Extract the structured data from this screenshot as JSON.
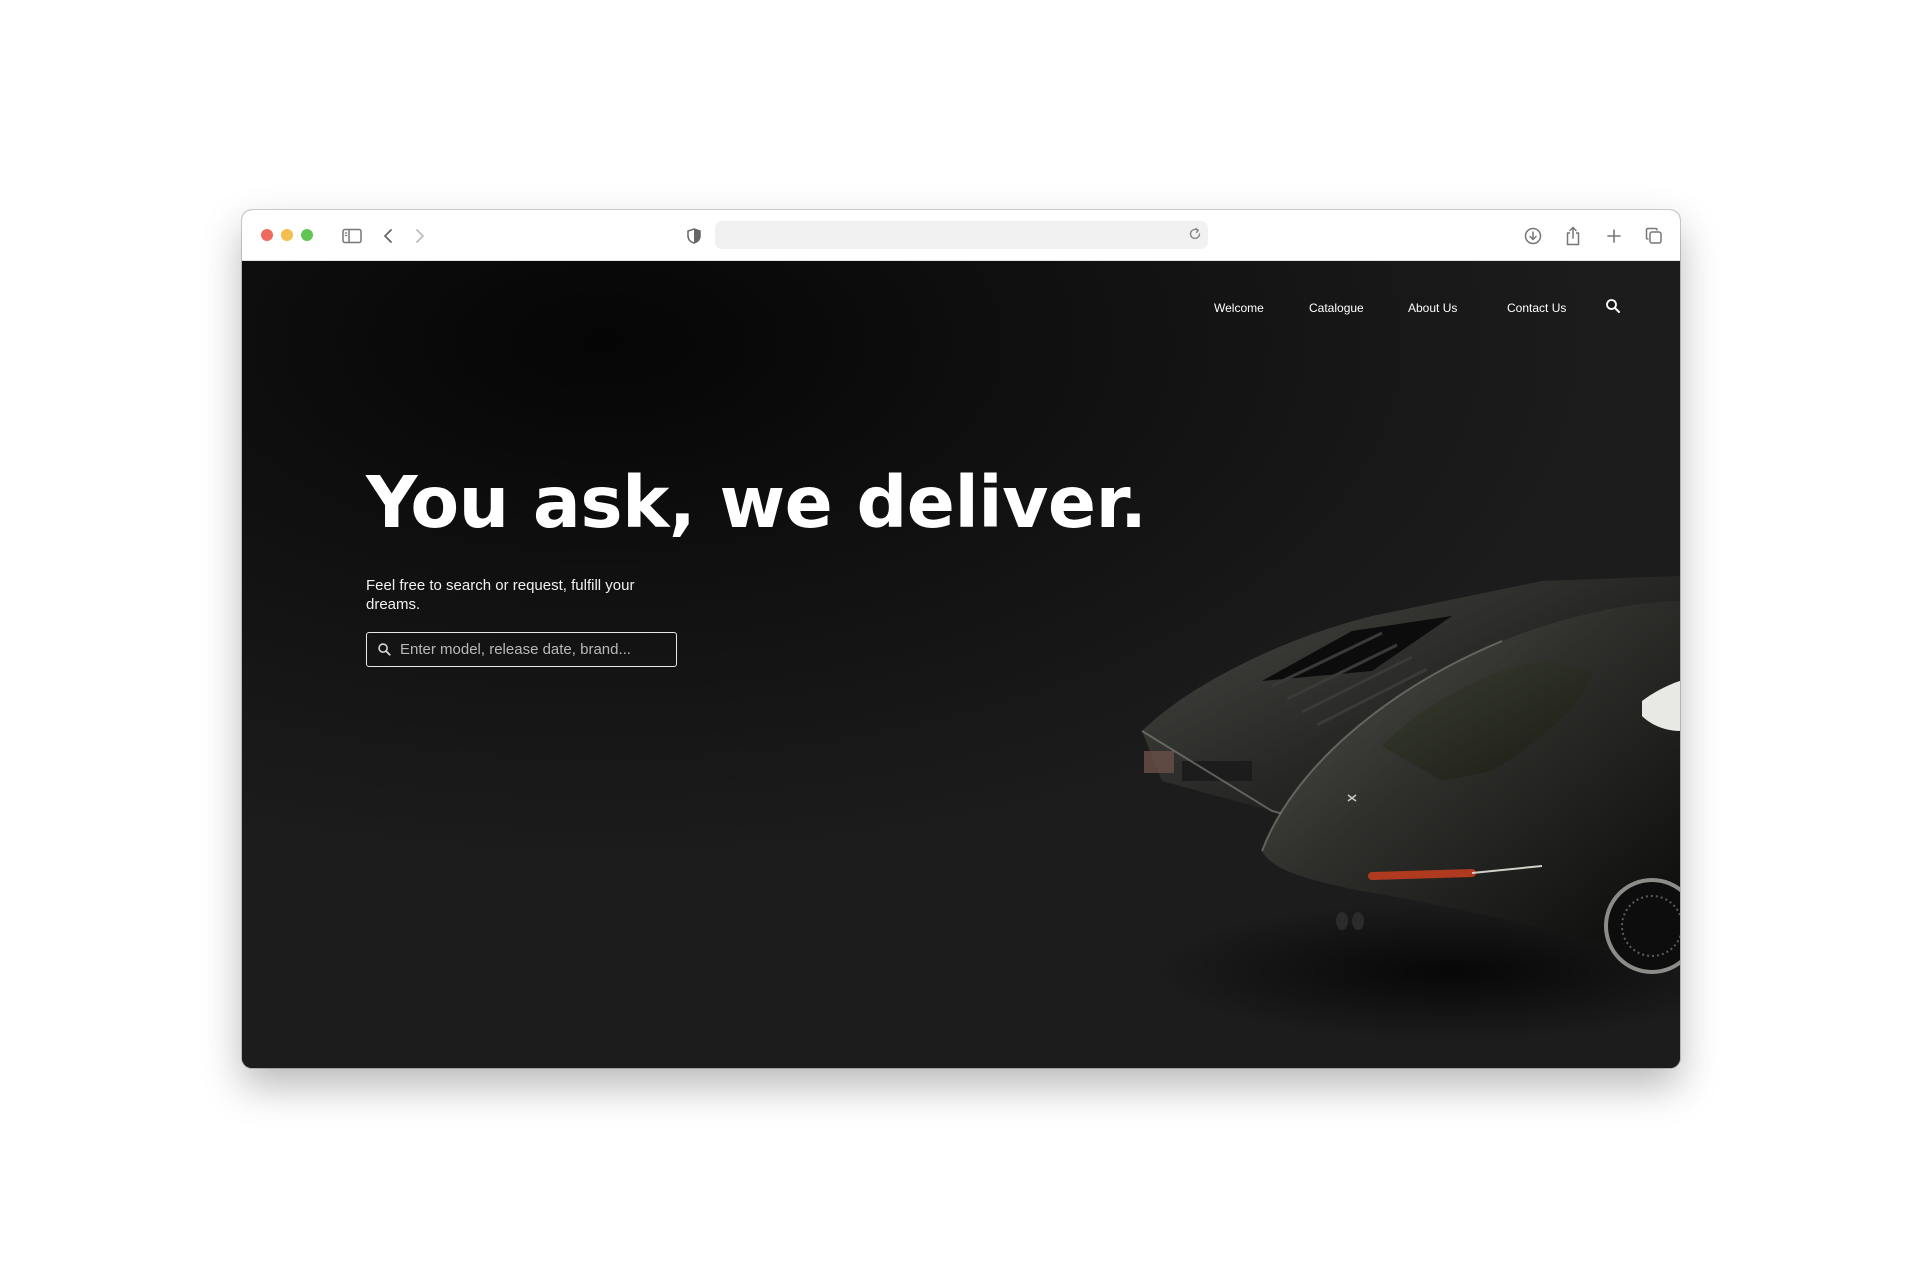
{
  "browser": {
    "traffic_lights": [
      "close",
      "minimize",
      "zoom"
    ],
    "colors": {
      "close": "#ec6a5e",
      "minimize": "#f4bf4f",
      "zoom": "#61c554"
    },
    "url": "",
    "icons": [
      "sidebar-icon",
      "back-icon",
      "forward-icon",
      "shield-icon",
      "reload-icon",
      "download-icon",
      "share-icon",
      "new-tab-icon",
      "tabs-overview-icon"
    ]
  },
  "nav": {
    "items": [
      "Welcome",
      "Catalogue",
      "About Us",
      "Contact Us"
    ],
    "search_icon": "search-icon"
  },
  "hero": {
    "title": "You ask, we deliver.",
    "subtitle": "Feel free to search or request, fulfill your dreams.",
    "search_placeholder": "Enter model, release date, brand..."
  },
  "image": {
    "subject": "two classic sports cars, rear view",
    "background_color": "#1a1a1a"
  }
}
